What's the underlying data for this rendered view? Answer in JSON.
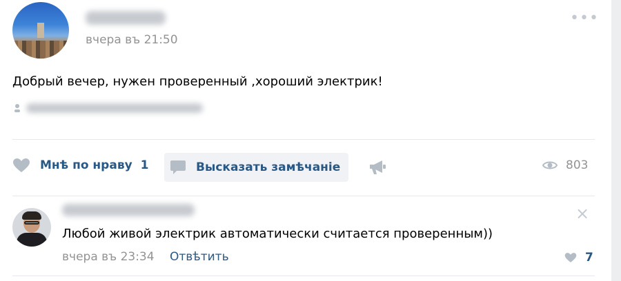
{
  "post": {
    "date": "вчера въ 21:50",
    "text": "Добрый вечер, нужен проверенный ,хороший электрик!",
    "more_icon": "more-dots-icon",
    "location_icon": "geo-pin-icon"
  },
  "actions": {
    "like_label": "Мнѣ по нраву",
    "like_count": "1",
    "comment_label": "Высказать замѣчаніе",
    "views_count": "803",
    "like_icon": "heart-icon",
    "comment_icon": "comment-bubble-icon",
    "share_icon": "megaphone-share-icon",
    "views_icon": "eye-icon"
  },
  "comment": {
    "text": "Любой живой электрик автоматически считается проверенным))",
    "date": "вчера въ 23:34",
    "reply_label": "Отвѣтить",
    "likes_count": "7",
    "close_icon": "close-icon"
  },
  "colors": {
    "link": "#2a5885",
    "muted": "#939393",
    "icon": "#b4bcc6",
    "background": "#edeef0"
  }
}
